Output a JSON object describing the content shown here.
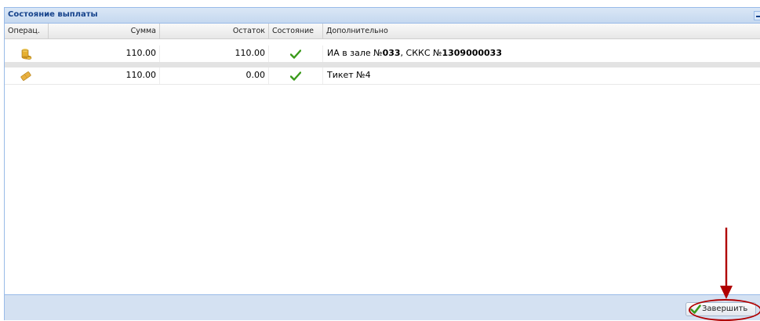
{
  "panel": {
    "title": "Состояние выплаты"
  },
  "columns": {
    "op": "Операц.",
    "sum": "Сумма",
    "rest": "Остаток",
    "state": "Состояние",
    "extra": "Дополнительно"
  },
  "rows": [
    {
      "op_icon": "coins-icon",
      "sum": "110.00",
      "rest": "110.00",
      "state": "success",
      "extra": {
        "p1": "ИА в зале №",
        "b1": "033",
        "p2": ", СККС №",
        "b2": "1309000033"
      }
    },
    {
      "op_icon": "ticket-icon",
      "sum": "110.00",
      "rest": "0.00",
      "state": "success",
      "extra": {
        "p1": "Тикет №4"
      }
    }
  ],
  "footer": {
    "finish_label": "Завершить"
  },
  "colors": {
    "header_text": "#15428b",
    "border": "#99bbe8",
    "footer_bg": "#d4e1f2",
    "check_green": "#3a9a1a",
    "annotation_red": "#b00000"
  }
}
